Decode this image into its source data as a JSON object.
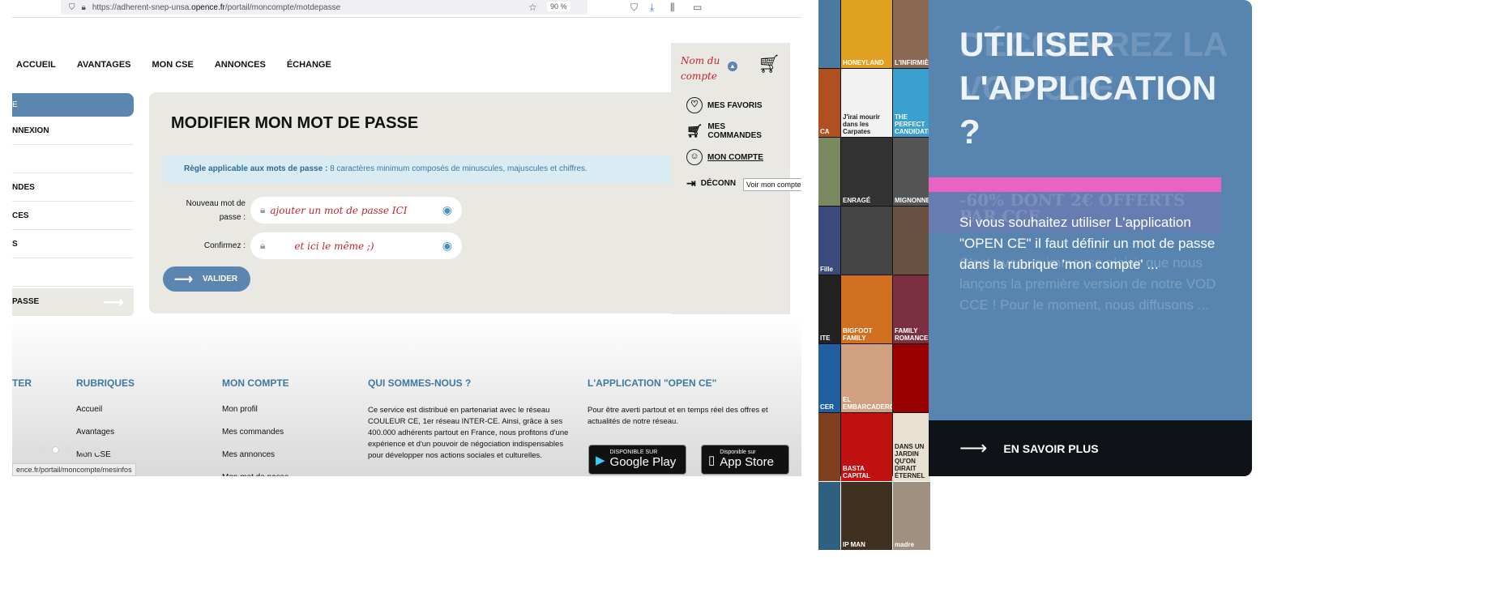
{
  "browser": {
    "url_prefix": "https://adherent-snep-unsa.",
    "url_domain": "opence.fr",
    "url_path": "/portail/moncompte/motdepasse",
    "zoom": "90 %",
    "status_url": "ence.fr/portail/moncompte/mesinfos"
  },
  "nav": [
    "ACCUEIL",
    "AVANTAGES",
    "MON CSE",
    "ANNONCES",
    "ÉCHANGE"
  ],
  "account": {
    "name": "Nom du compte",
    "menu": [
      "MES FAVORIS",
      "MES COMMANDES",
      "MON COMPTE",
      "DÉCONN"
    ],
    "tooltip": "Voir mon compte"
  },
  "sidebar": {
    "header": "E",
    "items": [
      "NNEXION",
      "",
      "NDES",
      "CES",
      "S",
      ""
    ],
    "active": "PASSE"
  },
  "form": {
    "title": "MODIFIER MON MOT DE PASSE",
    "rule_label": "Règle applicable aux mots de passe :",
    "rule_text": " 8 caractères minimum composés de minuscules, majuscules et chiffres.",
    "new_label": "Nouveau mot de passe :",
    "new_value": "ajouter un mot de passe ICI",
    "confirm_label": "Confirmez :",
    "confirm_value": "et ici le même ;)",
    "submit": "VALIDER"
  },
  "footer": {
    "col0": "TER",
    "rubriques": {
      "title": "RUBRIQUES",
      "links": [
        "Accueil",
        "Avantages",
        "Mon CSE"
      ]
    },
    "compte": {
      "title": "MON COMPTE",
      "links": [
        "Mon profil",
        "Mes commandes",
        "Mes annonces",
        "Mon mot de passe"
      ]
    },
    "qui": {
      "title": "QUI SOMMES-NOUS ?",
      "text": "Ce service est distribué en partenariat avec le réseau COULEUR CE, 1er réseau INTER-CE. Ainsi, grâce à ses 400.000 adhérents partout en France, nous profitons d'une expérience et d'un pouvoir de négociation indispensables pour développer nos actions sociales et culturelles."
    },
    "app": {
      "title": "L'APPLICATION \"OPEN CE\"",
      "text": "Pour être averti partout et en temps réel des offres et actualités de notre réseau.",
      "google_small": "DISPONIBLE SUR",
      "google": "Google Play",
      "apple_small": "Disponible sur",
      "apple": "App Store"
    }
  },
  "posters": [
    "",
    "HONEYLAND",
    "L'INFIRMIÈRE",
    "CA",
    "J'irai mourir dans les Carpates",
    "THE PERFECT CANDIDATE",
    "",
    "ENRAGÉ",
    "MIGNONNES",
    "Fille",
    "",
    "",
    "ITE",
    "BIGFOOT FAMILY",
    "FAMILY ROMANCE",
    "CER",
    "EL EMBARCADERO",
    "",
    "",
    "BASTA CAPITAL",
    "DANS UN JARDIN QU'ON DIRAIT ÉTERNEL",
    "",
    "IP MAN",
    "madre"
  ],
  "panel": {
    "title": "UTILISER L'APPLICATION ?",
    "ghost_title": "DÉCOUVREZ LA VOD CCE !",
    "ghost_promo": "-60% DONT 2€ OFFERTS PAR CCE",
    "text": "Si vous souhaitez utiliser L'application \"OPEN CE\" il faut définir un mot de passe dans la rubrique 'mon compte' ...",
    "ghost_text": "C'est avec un immense plaisir que nous lançons la première version de notre VOD CCE ! Pour le moment, nous diffusons ...",
    "cta": "EN SAVOIR PLUS"
  },
  "colors": {
    "accent": "#5785b0",
    "pink": "#e963c2",
    "dark": "#0f1216",
    "annotation": "#c0272d"
  }
}
